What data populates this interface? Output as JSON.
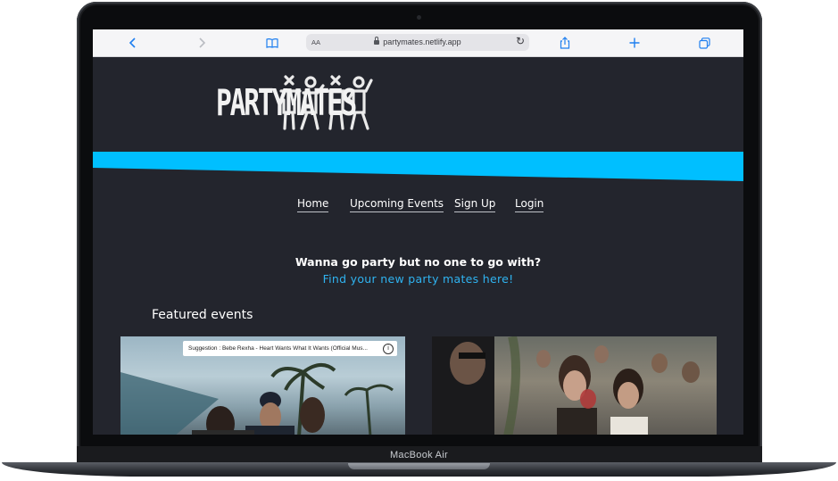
{
  "device": {
    "label": "MacBook Air"
  },
  "browser": {
    "text_size_label": "AA",
    "url": "partymates.netlify.app",
    "icons": [
      "back-icon",
      "forward-icon",
      "bookmarks-icon",
      "lock-icon",
      "reload-icon",
      "share-icon",
      "new-tab-icon",
      "tabs-icon"
    ]
  },
  "site": {
    "brand": "PARTYMATES",
    "nav": [
      "Home",
      "Upcoming Events",
      "Sign Up",
      "Login"
    ],
    "tagline": "Wanna go party but no one to go with?",
    "cta": "Find your new party mates here!",
    "featured_heading": "Featured events",
    "cards": [
      {
        "overlay": "Suggestion : Bebe Rexha - Heart Wants What It Wants (Official Mus...",
        "info_icon": "info-icon"
      },
      {
        "overlay": ""
      }
    ]
  },
  "colors": {
    "page_bg": "#23252d",
    "accent": "#00bfff",
    "link": "#2fb3f0",
    "text": "#ffffff"
  }
}
